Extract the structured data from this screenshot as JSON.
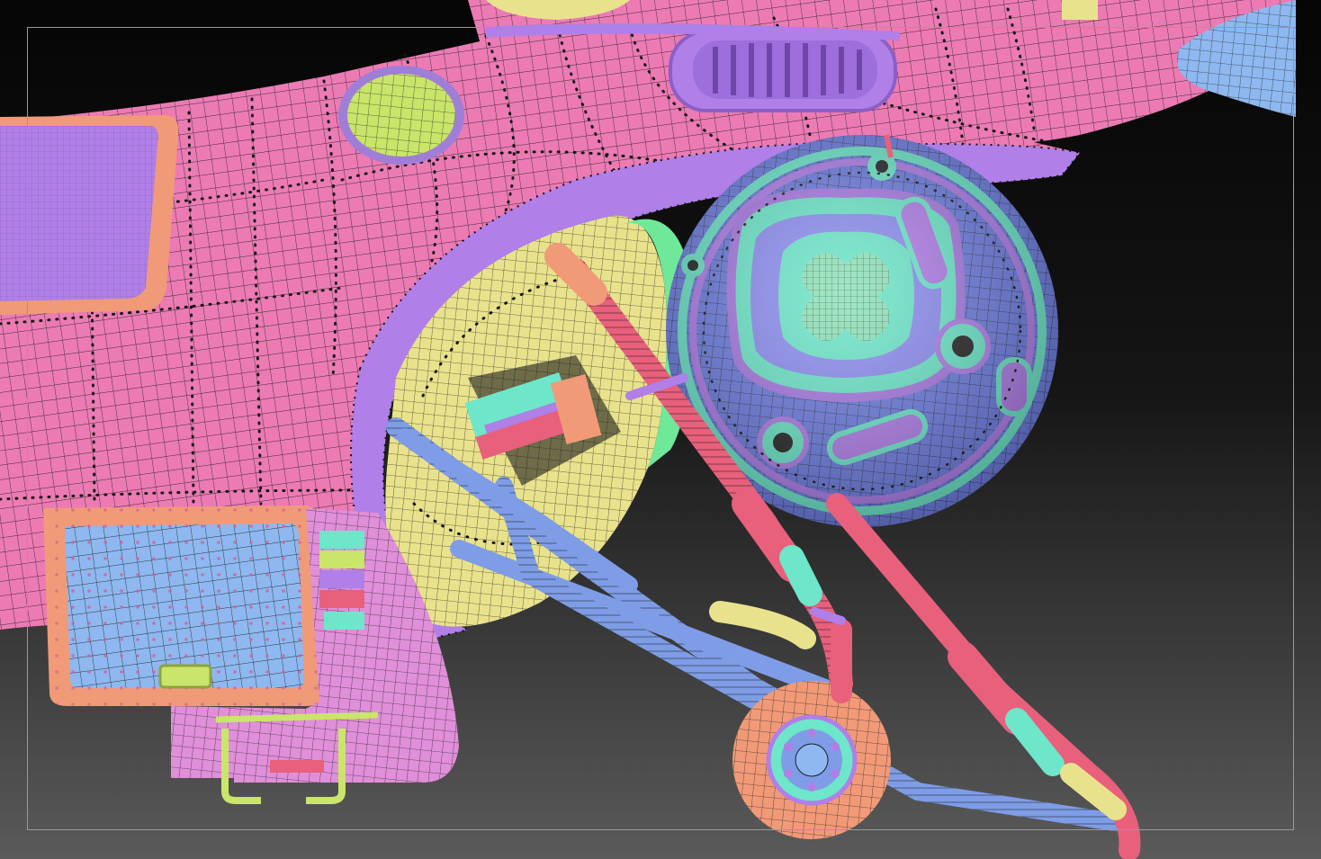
{
  "viewport": {
    "background_top": "#050505",
    "background_bottom": "#5a5a5a",
    "frame_color": "#9a9a9a"
  },
  "palette": {
    "hull_pink": "#ec7bb4",
    "violet": "#b07fe8",
    "yellow": "#e9e28c",
    "lime": "#c9e56a",
    "blue": "#7e9de6",
    "light_blue": "#8eb8ef",
    "salmon": "#f19a78",
    "teal": "#6ee6c9",
    "red_pink": "#e8607c",
    "wire": "#1c1c1c"
  }
}
